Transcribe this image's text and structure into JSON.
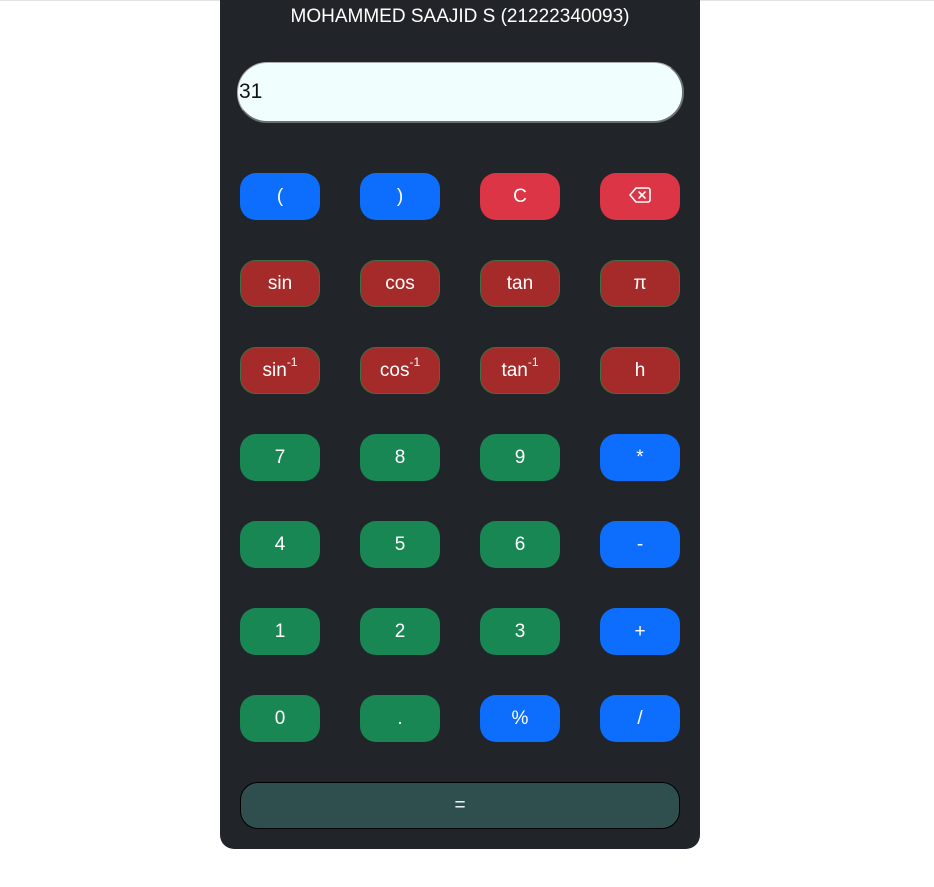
{
  "title": "MOHAMMED SAAJID S (21222340093)",
  "display": {
    "value": "31"
  },
  "buttons": {
    "open_paren": "(",
    "close_paren": ")",
    "clear": "C",
    "backspace_icon": "backspace-icon",
    "sin": "sin",
    "cos": "cos",
    "tan": "tan",
    "pi": "π",
    "asin_base": "sin",
    "acos_base": "cos",
    "atan_base": "tan",
    "inverse_sup": "-1",
    "h": "h",
    "seven": "7",
    "eight": "8",
    "nine": "9",
    "multiply": "*",
    "four": "4",
    "five": "5",
    "six": "6",
    "minus": "-",
    "one": "1",
    "two": "2",
    "three": "3",
    "plus": "+",
    "zero": "0",
    "dot": ".",
    "percent": "%",
    "divide": "/",
    "equals": "="
  },
  "colors": {
    "panel": "#212529",
    "operator_blue": "#0d6efd",
    "danger_red": "#dc3545",
    "trig_maroon": "#a52a2a",
    "digit_green": "#198754",
    "equals_slate": "#2f4f4f",
    "display_bg": "#f0fffe"
  }
}
